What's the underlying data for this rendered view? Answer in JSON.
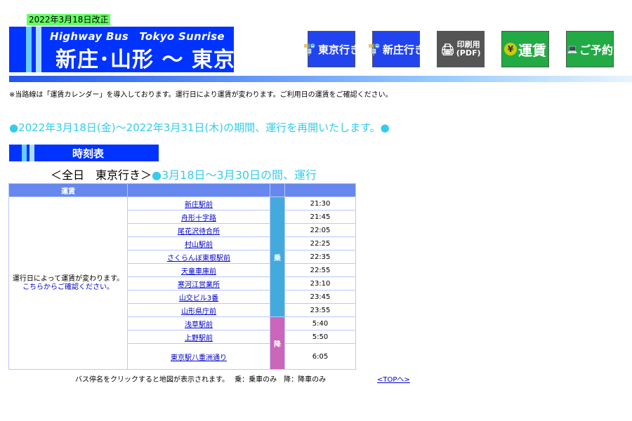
{
  "header": {
    "date_tag": "2022年3月18日改正",
    "brand_en": "Highway Bus　Tokyo Sunrise",
    "route_title": "新庄･山形 ～ 東京"
  },
  "nav": {
    "to_tokyo": "東京行き",
    "to_shinjo": "新庄行き",
    "print": "印刷用\n(PDF)",
    "fare": "運賃",
    "reserve": "ご予約"
  },
  "notice": "※当路線は「運賃カレンダー」を導入しております。運行日により運賃が変わります。ご利用日の運賃をご確認ください。",
  "period": "●2022年3月18日(金)～2022年3月31日(木)の期間、運行を再開いたします。●",
  "section_title": "時刻表",
  "subheading": {
    "prefix": "＜全日　東京行き＞",
    "range": "●3月18日～3月30日の間、運行"
  },
  "table": {
    "fare_header": "運賃",
    "fare_note": "運行日によって運賃が変わります。",
    "fare_link": "こちらからご確認ください。",
    "board_label": "乗",
    "alight_label": "降",
    "board_stops": [
      {
        "stop": "新庄駅前",
        "time": "21:30"
      },
      {
        "stop": "舟形十字路",
        "time": "21:45"
      },
      {
        "stop": "尾花沢待合所",
        "time": "22:05"
      },
      {
        "stop": "村山駅前",
        "time": "22:25"
      },
      {
        "stop": "さくらんぼ東根駅前",
        "time": "22:35"
      },
      {
        "stop": "天童車庫前",
        "time": "22:55"
      },
      {
        "stop": "寒河江営業所",
        "time": "23:10"
      },
      {
        "stop": "山交ビル3番",
        "time": "23:45"
      },
      {
        "stop": "山形県庁前",
        "time": "23:55"
      }
    ],
    "alight_stops": [
      {
        "stop": "浅草駅前",
        "time": "5:40"
      },
      {
        "stop": "上野駅前",
        "time": "5:50"
      },
      {
        "stop": "東京駅八重洲通り",
        "time": "6:05"
      }
    ]
  },
  "footer": {
    "note": "バス停名をクリックすると地図が表示されます。　 乗：乗車のみ　降：降車のみ",
    "top_link": "<TOPへ>"
  }
}
